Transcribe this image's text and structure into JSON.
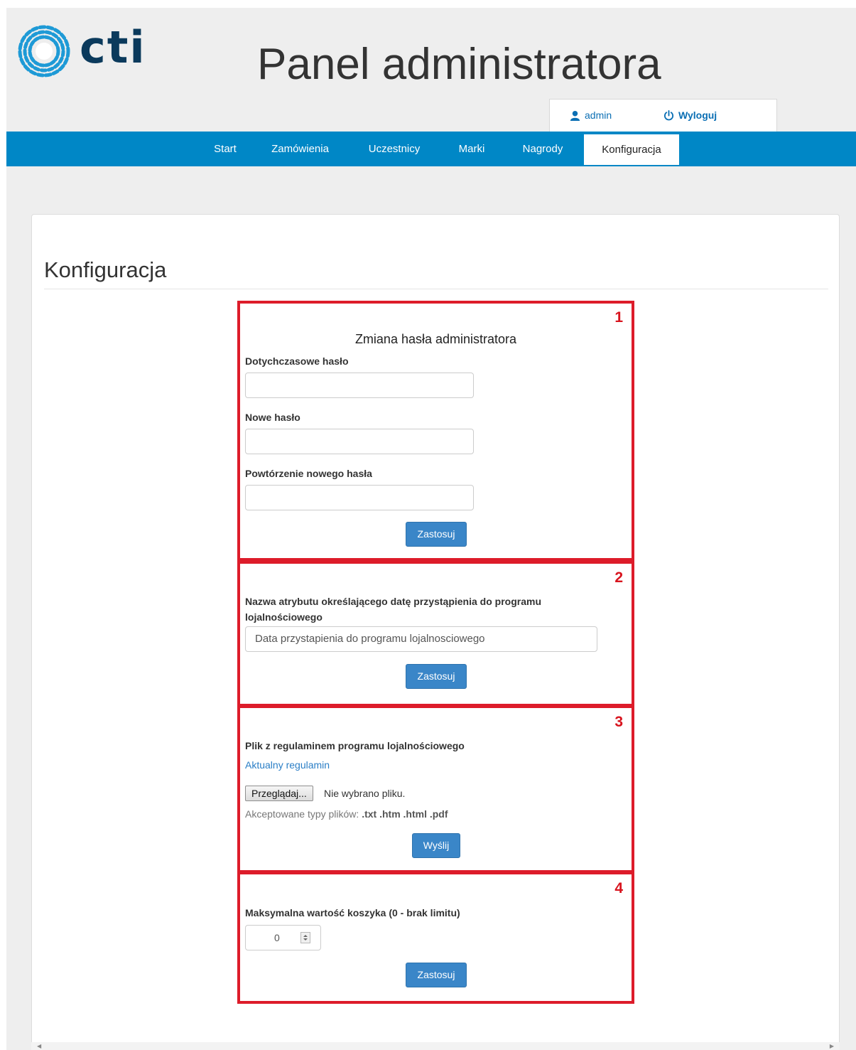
{
  "header": {
    "logo_text": "cti",
    "title": "Panel administratora",
    "user_label": "admin",
    "logout_label": "Wyloguj"
  },
  "nav": {
    "items": [
      {
        "label": "Start"
      },
      {
        "label": "Zamówienia"
      },
      {
        "label": "Uczestnicy"
      },
      {
        "label": "Marki"
      },
      {
        "label": "Nagrody"
      },
      {
        "label": "Konfiguracja"
      }
    ],
    "active": "Konfiguracja"
  },
  "page": {
    "title": "Konfiguracja"
  },
  "sections": [
    {
      "number": "1",
      "title": "Zmiana hasła administratora",
      "fields": [
        {
          "label": "Dotychczasowe hasło",
          "value": ""
        },
        {
          "label": "Nowe hasło",
          "value": ""
        },
        {
          "label": "Powtórzenie nowego hasła",
          "value": ""
        }
      ],
      "button": "Zastosuj"
    },
    {
      "number": "2",
      "label_line1": "Nazwa atrybutu określającego datę przystąpienia do programu",
      "label_line2": "lojalnościowego",
      "value": "Data przystapienia do programu lojalnosciowego",
      "button": "Zastosuj"
    },
    {
      "number": "3",
      "label": "Plik z regulaminem programu lojalnościowego",
      "link": "Aktualny regulamin",
      "file_button": "Przeglądaj...",
      "file_status": "Nie wybrano pliku.",
      "help_prefix": "Akceptowane typy plików:",
      "help_types": ".txt .htm .html .pdf",
      "button": "Wyślij"
    },
    {
      "number": "4",
      "label": "Maksymalna wartość koszyka (0 - brak limitu)",
      "value": "0",
      "button": "Zastosuj"
    }
  ],
  "colors": {
    "navbar": "#0087c6",
    "button": "#3a86c8",
    "highlight_border": "#dd1c2a",
    "link": "#2a7ec6",
    "logo_blue": "#1e9ad6",
    "logo_dark": "#0b3a5c"
  }
}
